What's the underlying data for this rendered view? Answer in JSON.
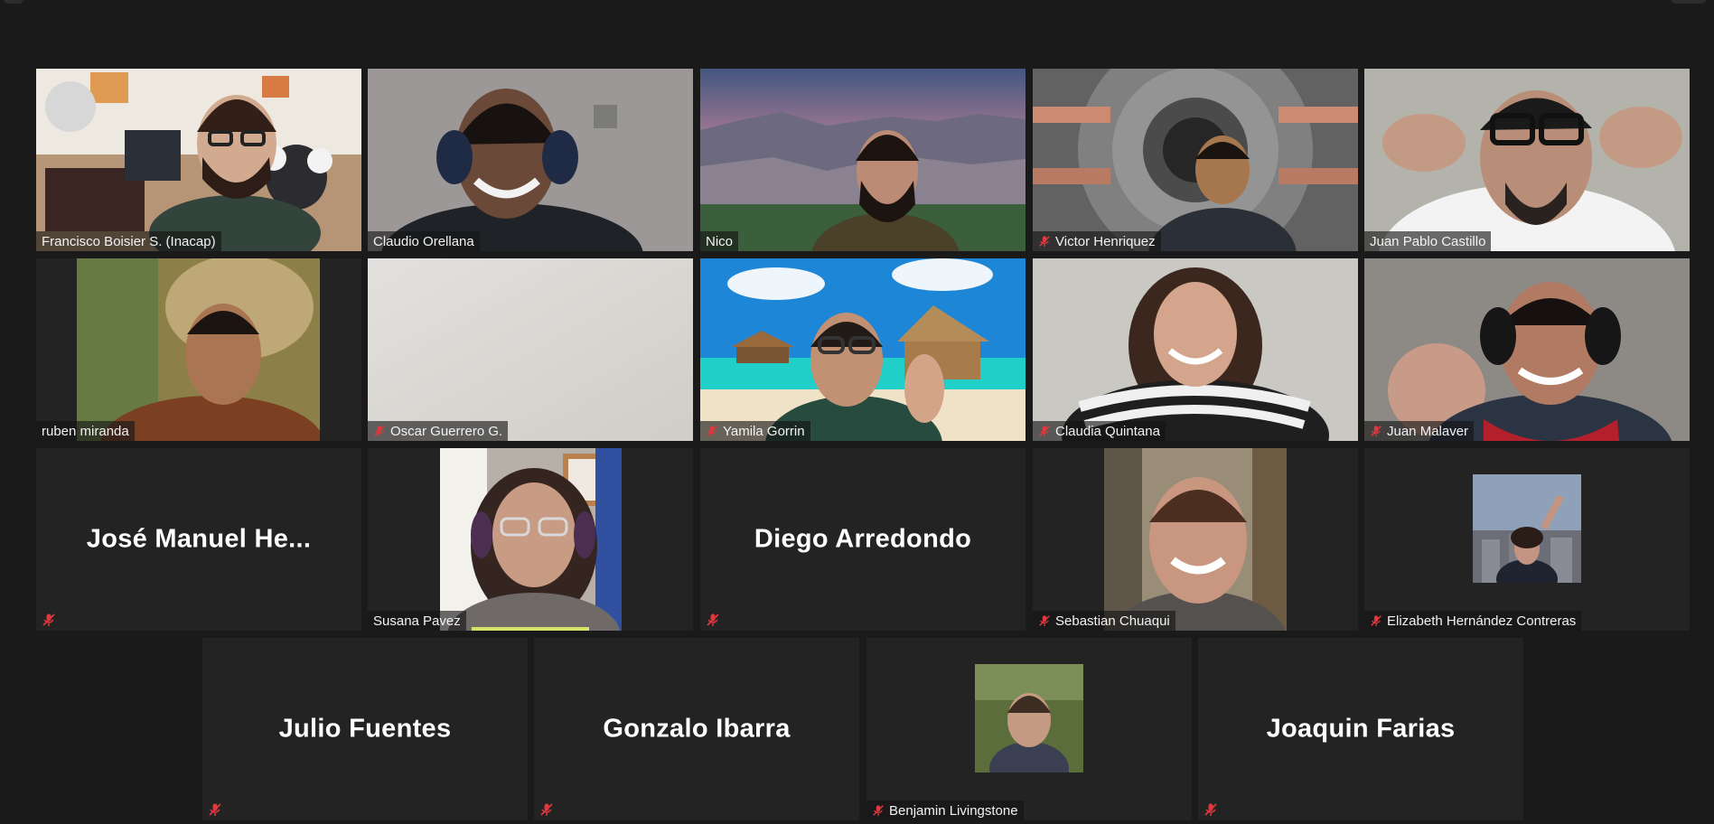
{
  "meeting": {
    "participants": [
      {
        "id": "p1",
        "name": "Francisco Boisier S. (Inacap)",
        "muted": false,
        "video": true,
        "speaking": false
      },
      {
        "id": "p2",
        "name": "Claudio Orellana",
        "muted": false,
        "video": true,
        "speaking": true
      },
      {
        "id": "p3",
        "name": "Nico",
        "muted": false,
        "video": true,
        "speaking": false
      },
      {
        "id": "p4",
        "name": "Victor Henriquez",
        "muted": true,
        "video": true,
        "speaking": false
      },
      {
        "id": "p5",
        "name": "Juan Pablo Castillo",
        "muted": false,
        "video": true,
        "speaking": false
      },
      {
        "id": "p6",
        "name": "ruben miranda",
        "muted": false,
        "video": true,
        "speaking": false
      },
      {
        "id": "p7",
        "name": "Oscar Guerrero G.",
        "muted": true,
        "video": true,
        "speaking": false
      },
      {
        "id": "p8",
        "name": "Yamila Gorrin",
        "muted": true,
        "video": true,
        "speaking": false
      },
      {
        "id": "p9",
        "name": "Claudia Quintana",
        "muted": true,
        "video": true,
        "speaking": false
      },
      {
        "id": "p10",
        "name": "Juan Malaver",
        "muted": true,
        "video": true,
        "speaking": false
      },
      {
        "id": "p11",
        "name": "José Manuel He...",
        "muted": true,
        "video": false,
        "speaking": false
      },
      {
        "id": "p12",
        "name": "Susana Pavez",
        "muted": false,
        "video": true,
        "speaking": false
      },
      {
        "id": "p13",
        "name": "Diego Arredondo",
        "muted": true,
        "video": false,
        "speaking": false
      },
      {
        "id": "p14",
        "name": "Sebastian Chuaqui",
        "muted": true,
        "video": true,
        "speaking": false
      },
      {
        "id": "p15",
        "name": "Elizabeth Hernández Contreras",
        "muted": true,
        "video": false,
        "speaking": false
      },
      {
        "id": "p16",
        "name": "Julio Fuentes",
        "muted": true,
        "video": false,
        "speaking": false
      },
      {
        "id": "p17",
        "name": "Gonzalo Ibarra",
        "muted": true,
        "video": false,
        "speaking": false
      },
      {
        "id": "p18",
        "name": "Benjamin Livingstone",
        "muted": true,
        "video": false,
        "speaking": false
      },
      {
        "id": "p19",
        "name": "Joaquin Farias",
        "muted": true,
        "video": false,
        "speaking": false
      }
    ]
  },
  "colors": {
    "background": "#1a1a1a",
    "tile": "#232323",
    "speaking_outline": "#d5e36a",
    "muted_icon": "#e0383e"
  },
  "icons": {
    "muted": "microphone-muted-icon"
  }
}
